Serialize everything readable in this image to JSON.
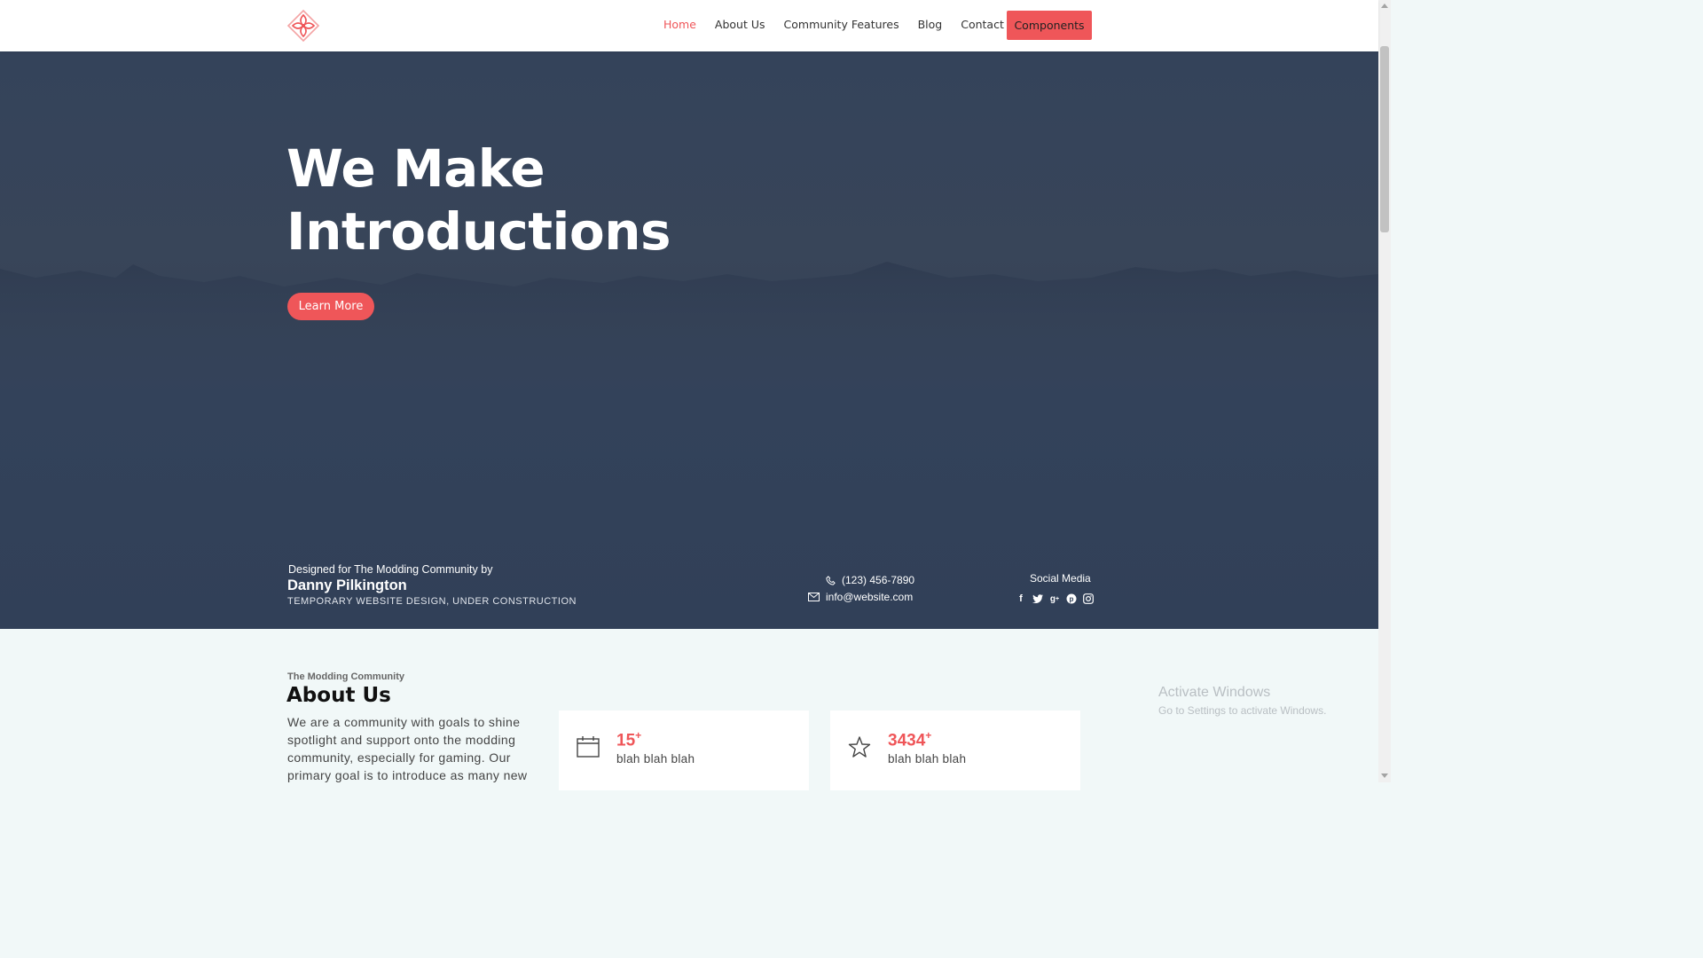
{
  "nav": {
    "items": [
      {
        "label": "Home",
        "active": true
      },
      {
        "label": "About Us"
      },
      {
        "label": "Community Features"
      },
      {
        "label": "Blog"
      },
      {
        "label": "Contact"
      }
    ],
    "cta_label": "Components",
    "logo_icon": "diamond-petal-logo"
  },
  "hero": {
    "title_line1": "We Make",
    "title_line2": "Introductions",
    "button_label": "Learn More"
  },
  "credits": {
    "designed_for": "Designed for The Modding Community by",
    "author": "Danny Pilkington",
    "note": "TEMPORARY WEBSITE DESIGN, UNDER CONSTRUCTION"
  },
  "contact": {
    "phone": "(123) 456-7890",
    "email": "info@website.com"
  },
  "social": {
    "label": "Social Media",
    "icons": [
      "facebook-icon",
      "twitter-icon",
      "google-plus-icon",
      "pinterest-icon",
      "instagram-icon"
    ]
  },
  "about": {
    "kicker": "The Modding Community",
    "title": "About Us",
    "text": "We are a community with goals to shine spotlight and support onto the modding community, especially for gaming. Our primary goal is to introduce as many new"
  },
  "stats": [
    {
      "number": "15",
      "suffix": "+",
      "label": "blah blah blah",
      "icon": "calendar-icon"
    },
    {
      "number": "3434",
      "suffix": "+",
      "label": "blah blah blah",
      "icon": "star-icon"
    }
  ],
  "watermark": {
    "title": "Activate Windows",
    "subtitle": "Go to Settings to activate Windows."
  },
  "colors": {
    "accent": "#ef5659",
    "hero_bg": "#34435a",
    "about_bg": "#f1f8f8"
  }
}
